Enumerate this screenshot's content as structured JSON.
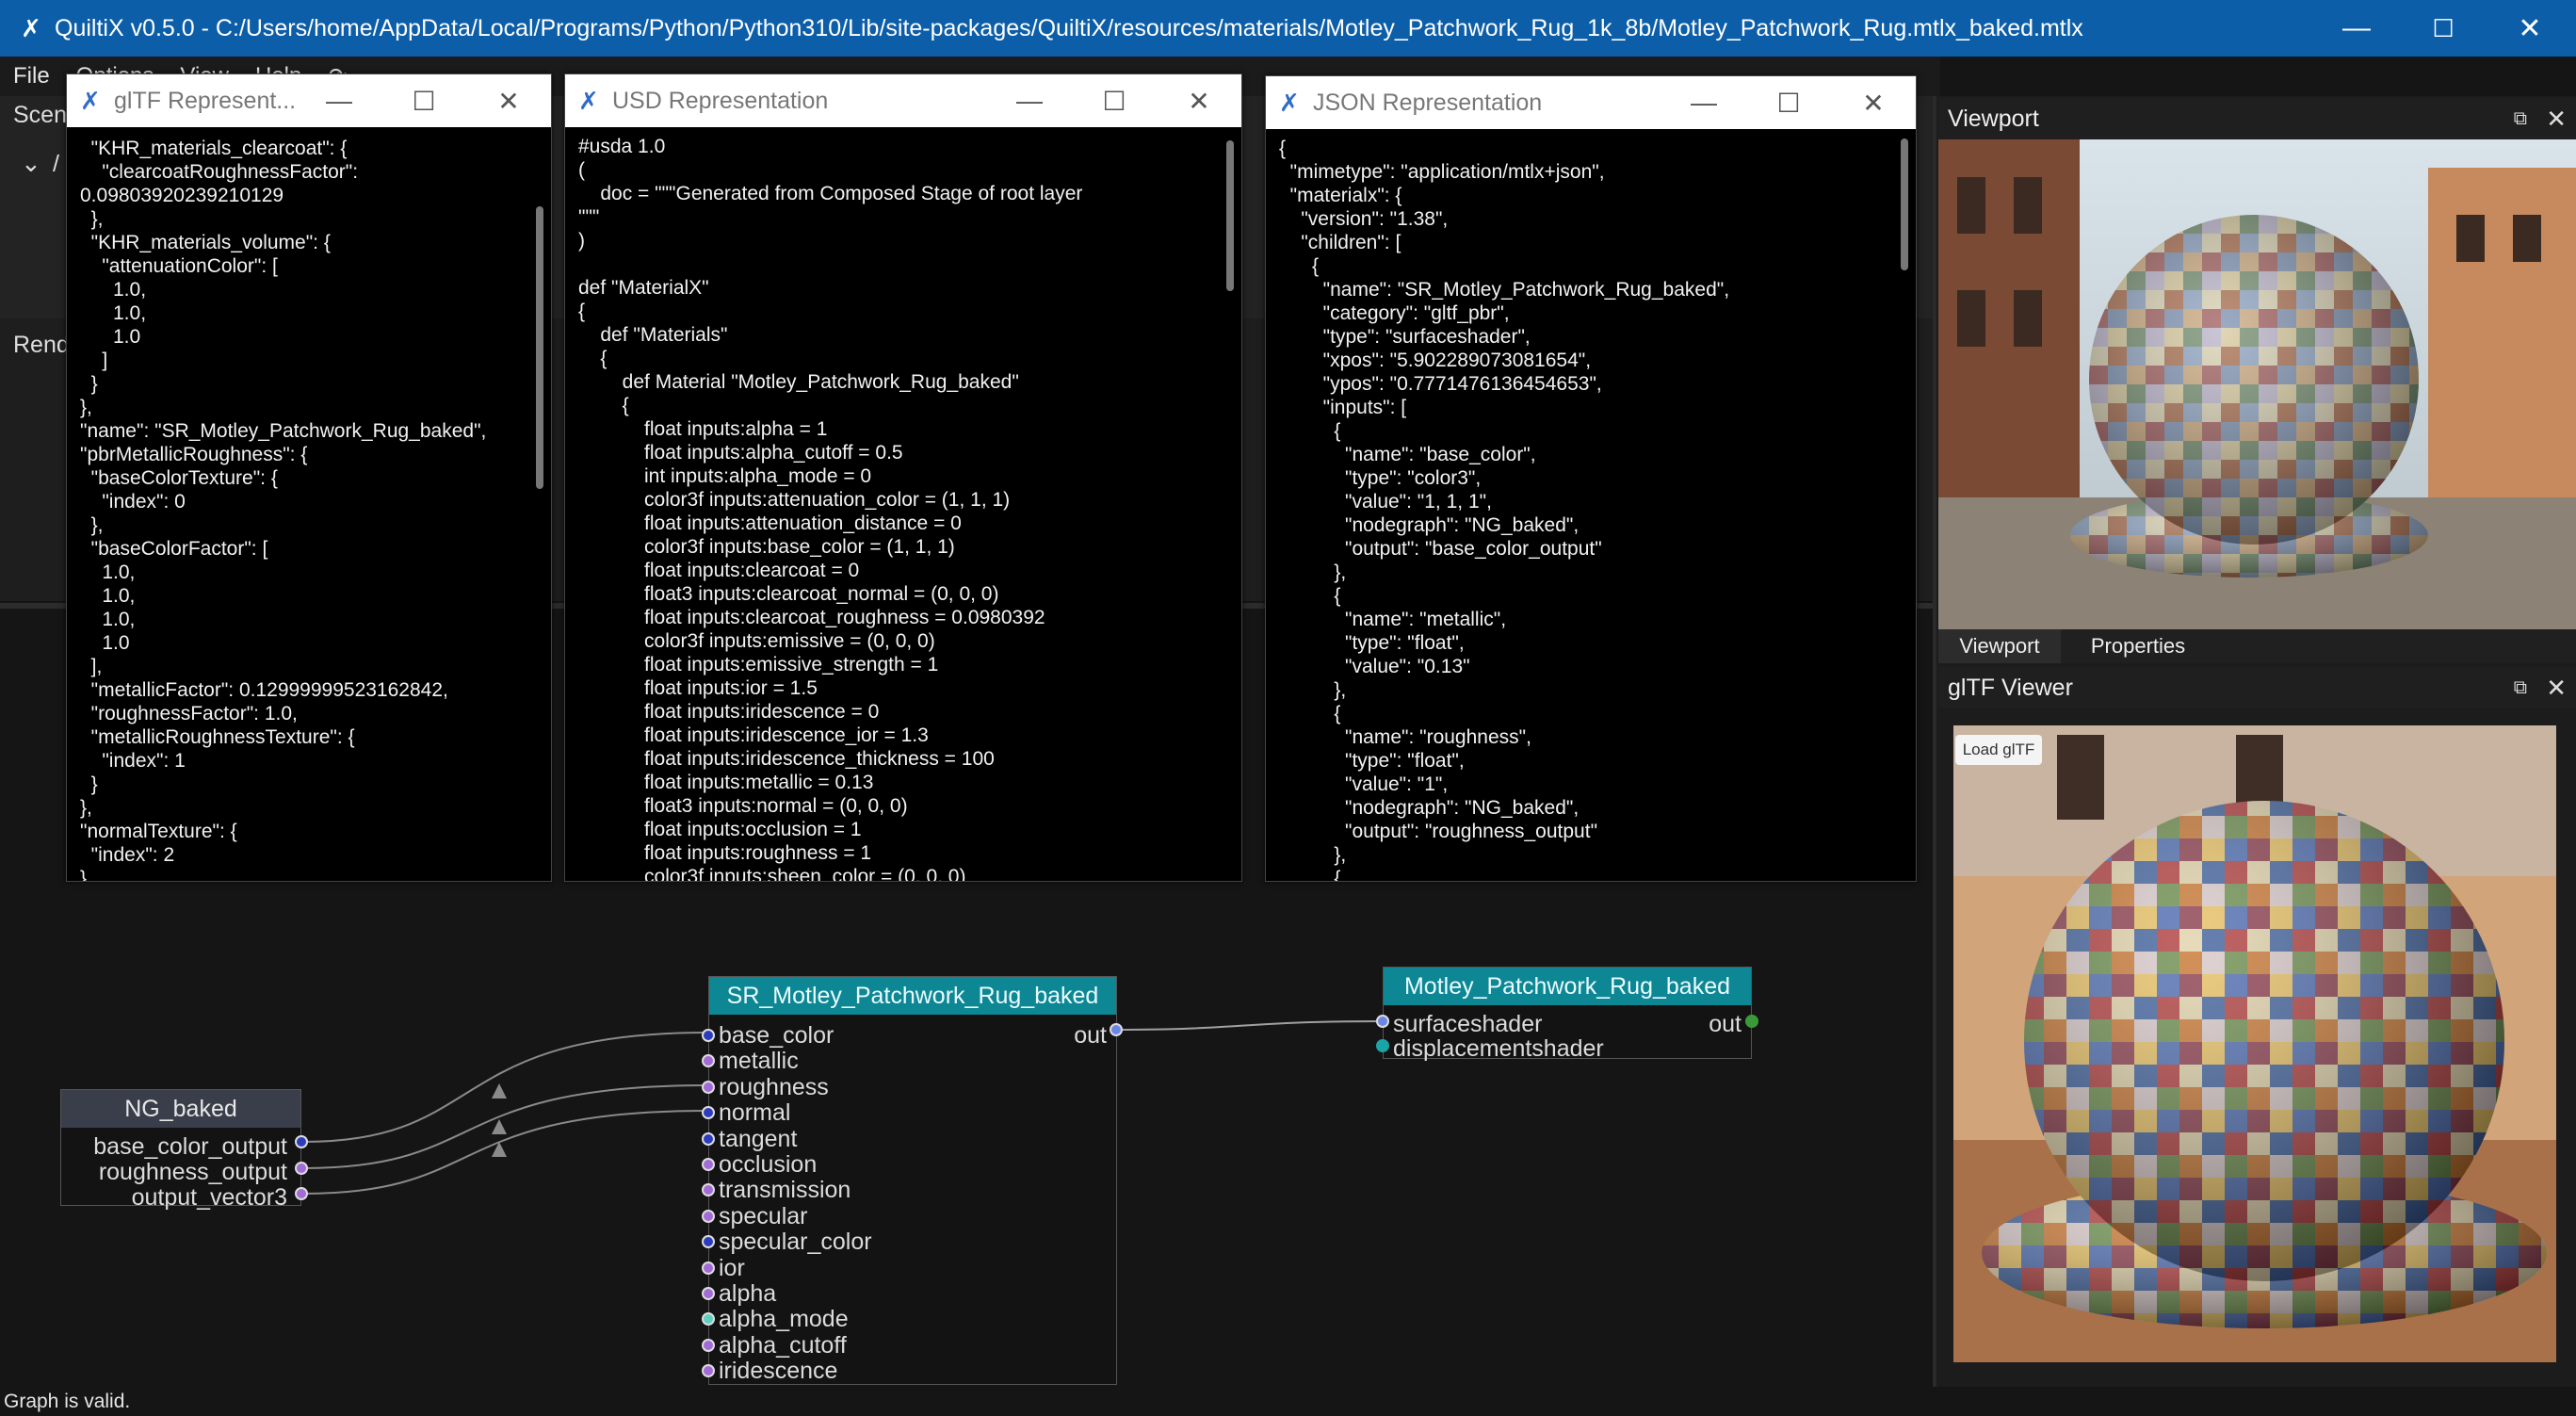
{
  "titlebar": {
    "title": "QuiltiX v0.5.0 - C:/Users/home/AppData/Local/Programs/Python/Python310/Lib/site-packages/QuiltiX/resources/materials/Motley_Patchwork_Rug_1k_8b/Motley_Patchwork_Rug.mtlx_baked.mtlx",
    "minimize": "—",
    "maximize": "☐",
    "close": "✕"
  },
  "menu": {
    "file": "File",
    "options": "Options",
    "view": "View",
    "help": "Help"
  },
  "background_labels": {
    "scene": "Scene",
    "render": "Rend",
    "tree_expand": "⌄",
    "tree_root": "/"
  },
  "windows": {
    "gltf": {
      "title": "glTF Represent...",
      "text": "  \"KHR_materials_clearcoat\": {\n    \"clearcoatRoughnessFactor\":\n0.09803920239210129\n  },\n  \"KHR_materials_volume\": {\n    \"attenuationColor\": [\n      1.0,\n      1.0,\n      1.0\n    ]\n  }\n},\n\"name\": \"SR_Motley_Patchwork_Rug_baked\",\n\"pbrMetallicRoughness\": {\n  \"baseColorTexture\": {\n    \"index\": 0\n  },\n  \"baseColorFactor\": [\n    1.0,\n    1.0,\n    1.0,\n    1.0\n  ],\n  \"metallicFactor\": 0.12999999523162842,\n  \"roughnessFactor\": 1.0,\n  \"metallicRoughnessTexture\": {\n    \"index\": 1\n  }\n},\n\"normalTexture\": {\n  \"index\": 2\n}"
    },
    "usd": {
      "title": "USD Representation",
      "text": "#usda 1.0\n(\n    doc = \"\"\"Generated from Composed Stage of root layer\n\"\"\"\n)\n\ndef \"MaterialX\"\n{\n    def \"Materials\"\n    {\n        def Material \"Motley_Patchwork_Rug_baked\"\n        {\n            float inputs:alpha = 1\n            float inputs:alpha_cutoff = 0.5\n            int inputs:alpha_mode = 0\n            color3f inputs:attenuation_color = (1, 1, 1)\n            float inputs:attenuation_distance = 0\n            color3f inputs:base_color = (1, 1, 1)\n            float inputs:clearcoat = 0\n            float3 inputs:clearcoat_normal = (0, 0, 0)\n            float inputs:clearcoat_roughness = 0.0980392\n            color3f inputs:emissive = (0, 0, 0)\n            float inputs:emissive_strength = 1\n            float inputs:ior = 1.5\n            float inputs:iridescence = 0\n            float inputs:iridescence_ior = 1.3\n            float inputs:iridescence_thickness = 100\n            float inputs:metallic = 0.13\n            float3 inputs:normal = (0, 0, 0)\n            float inputs:occlusion = 1\n            float inputs:roughness = 1\n            color3f inputs:sheen_color = (0, 0, 0)"
    },
    "json": {
      "title": "JSON Representation",
      "text": "{\n  \"mimetype\": \"application/mtlx+json\",\n  \"materialx\": {\n    \"version\": \"1.38\",\n    \"children\": [\n      {\n        \"name\": \"SR_Motley_Patchwork_Rug_baked\",\n        \"category\": \"gltf_pbr\",\n        \"type\": \"surfaceshader\",\n        \"xpos\": \"5.902289073081654\",\n        \"ypos\": \"0.7771476136454653\",\n        \"inputs\": [\n          {\n            \"name\": \"base_color\",\n            \"type\": \"color3\",\n            \"value\": \"1, 1, 1\",\n            \"nodegraph\": \"NG_baked\",\n            \"output\": \"base_color_output\"\n          },\n          {\n            \"name\": \"metallic\",\n            \"type\": \"float\",\n            \"value\": \"0.13\"\n          },\n          {\n            \"name\": \"roughness\",\n            \"type\": \"float\",\n            \"value\": \"1\",\n            \"nodegraph\": \"NG_baked\",\n            \"output\": \"roughness_output\"\n          },\n          {"
    },
    "win_min": "—",
    "win_max": "☐",
    "win_close": "✕"
  },
  "dock": {
    "viewport_title": "Viewport",
    "tabs": [
      "Viewport",
      "Properties"
    ],
    "gltf_viewer_title": "glTF Viewer",
    "load_gltf": "Load glTF",
    "float_icon": "⧉",
    "close_icon": "✕"
  },
  "graph": {
    "ng_node": {
      "title": "NG_baked",
      "outputs": [
        "base_color_output",
        "roughness_output",
        "output_vector3"
      ]
    },
    "sr_node": {
      "title": "SR_Motley_Patchwork_Rug_baked",
      "output": "out",
      "inputs": [
        "base_color",
        "metallic",
        "roughness",
        "normal",
        "tangent",
        "occlusion",
        "transmission",
        "specular",
        "specular_color",
        "ior",
        "alpha",
        "alpha_mode",
        "alpha_cutoff",
        "iridescence"
      ]
    },
    "mat_node": {
      "title": "Motley_Patchwork_Rug_baked",
      "output": "out",
      "inputs": [
        "surfaceshader",
        "displacementshader"
      ]
    }
  },
  "status": {
    "text": "Graph is valid."
  },
  "colors": {
    "titlebar": "#0d5ea8",
    "node_header": "#0e8794",
    "port": "#b48ee0"
  }
}
